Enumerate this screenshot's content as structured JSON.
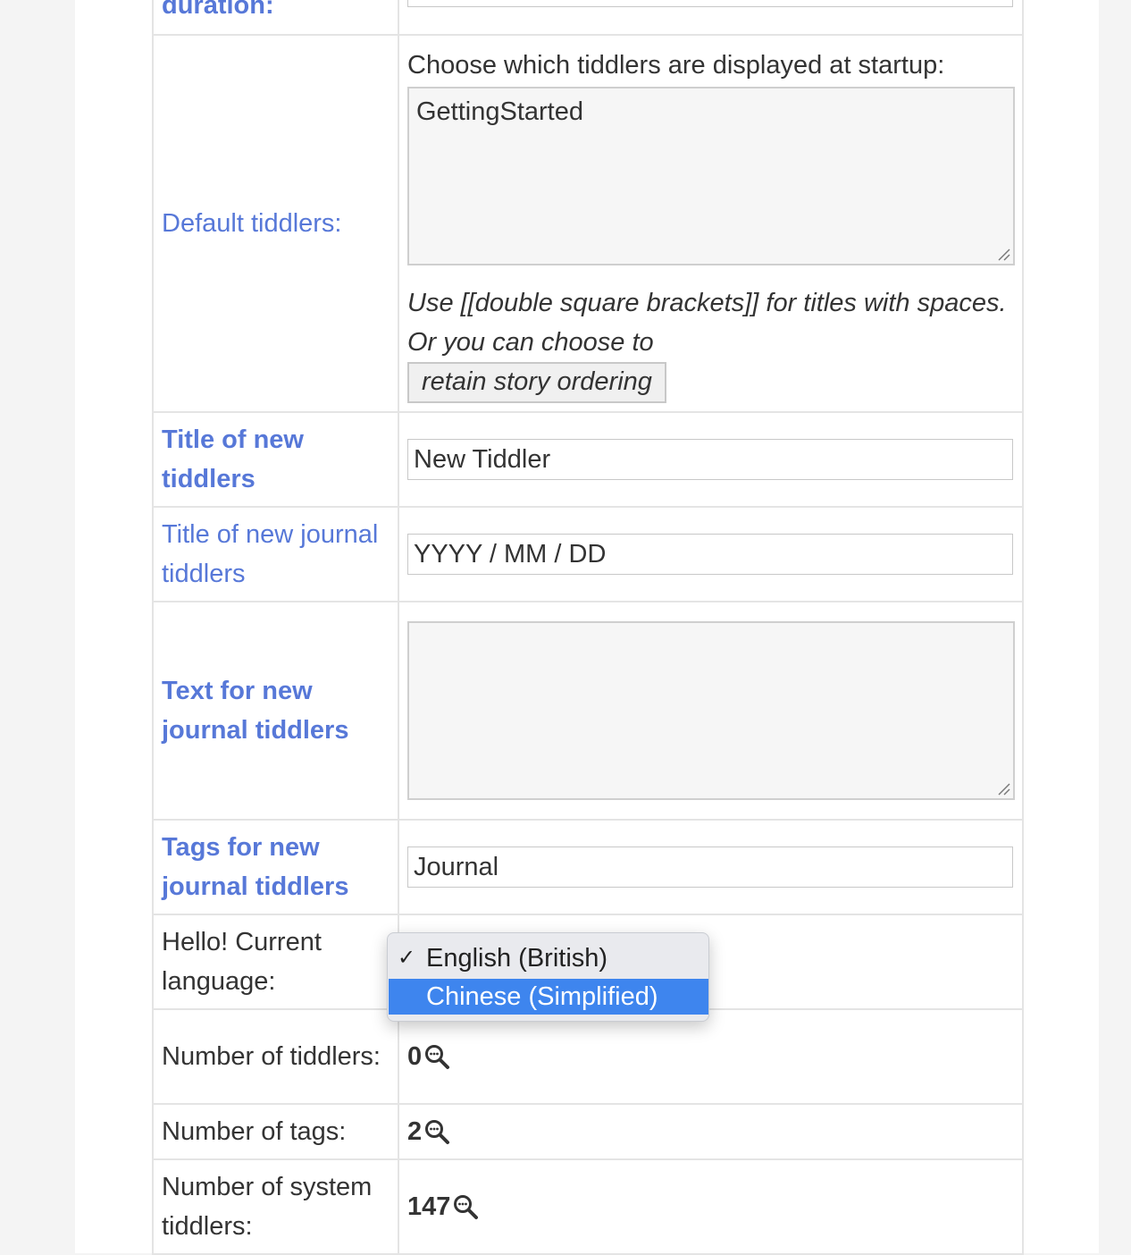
{
  "rows": {
    "duration": {
      "label": "duration:"
    },
    "default_tiddlers": {
      "label": "Default tiddlers:",
      "prompt": "Choose which tiddlers are displayed at startup:",
      "value": "GettingStarted",
      "hint": "Use [[double square brackets]] for titles with spaces. Or you can choose to",
      "button_label": "retain story ordering"
    },
    "new_title": {
      "label": "Title of new tiddlers",
      "value": "New Tiddler"
    },
    "journal_title": {
      "label": "Title of new journal tiddlers",
      "value": "YYYY / MM / DD"
    },
    "journal_text": {
      "label": "Text for new journal tiddlers",
      "value": ""
    },
    "journal_tags": {
      "label": "Tags for new journal tiddlers",
      "value": "Journal"
    },
    "language": {
      "label": "Hello! Current language:"
    },
    "num_tiddlers": {
      "label": "Number of tiddlers:",
      "value": "0"
    },
    "num_tags": {
      "label": "Number of tags:",
      "value": "2"
    },
    "num_system": {
      "label": "Number of system tiddlers:",
      "value": "147"
    }
  },
  "language_dropdown": {
    "options": [
      {
        "label": "English (British)",
        "checked": true,
        "highlighted": false
      },
      {
        "label": "Chinese (Simplified)",
        "checked": false,
        "highlighted": true
      }
    ],
    "check_glyph": "✓"
  },
  "colors": {
    "link": "#5778d8",
    "highlight": "#3e85ee",
    "border": "#e4e4e4"
  },
  "icons": {
    "count_search": "magnifier-with-dots-icon",
    "textarea_resize": "resize-grip-icon"
  }
}
